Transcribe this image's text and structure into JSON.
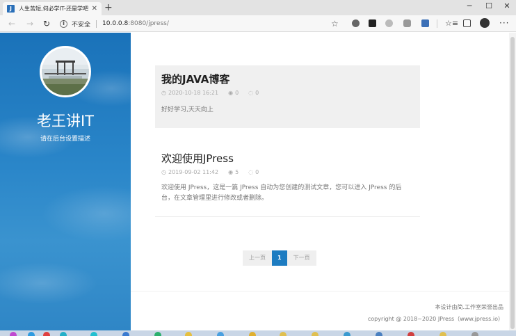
{
  "browser": {
    "tab_title": "人生苦短,何必学IT-还是学吧",
    "tab_favicon": "J",
    "security_label": "不安全",
    "url_host": "10.0.0.8",
    "url_path": ":8080/jpress/",
    "icons": {
      "back": "arrow-left-icon",
      "forward": "arrow-right-icon",
      "reload": "reload-icon",
      "info": "info-icon",
      "star": "star-icon",
      "favorites": "favorites-icon",
      "collections": "collections-icon",
      "more": "more-icon"
    }
  },
  "site": {
    "title": "老王讲IT",
    "description": "请在后台设置描述"
  },
  "posts": [
    {
      "title": "我的JAVA博客",
      "date": "2020-10-18 16:21",
      "views": "0",
      "comments": "0",
      "excerpt": "好好学习,天天向上"
    },
    {
      "title": "欢迎使用JPress",
      "date": "2019-09-02 11:42",
      "views": "5",
      "comments": "0",
      "excerpt": "欢迎使用 JPress，这是一篇 JPress 自动为您创建的测试文章，您可以进入 JPress 的后台，在文章管理里进行修改或者删除。"
    }
  ],
  "pagination": {
    "prev": "上一页",
    "current": "1",
    "next": "下一页"
  },
  "footer": {
    "line1": "本设计由简.工作室荣誉出品",
    "line2": "copyright @ 2018~2020 JPress（www.jpress.io）"
  },
  "colors": {
    "accent": "#1d7cc1",
    "sidebar": "#2a86c9"
  }
}
